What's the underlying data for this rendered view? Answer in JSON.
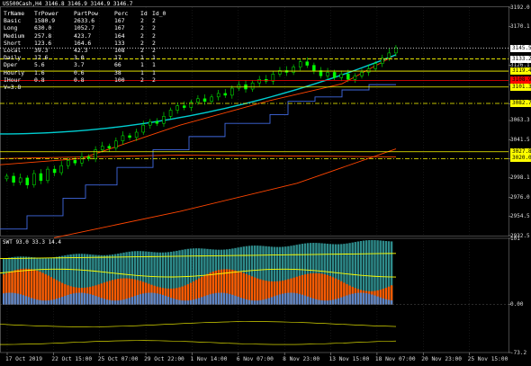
{
  "chart_title": "US500Cash,H4  3146.8 3146.9 3144.9 3146.7",
  "stats_table": {
    "headers": [
      "TrName",
      "TrPower",
      "PartPow",
      "Perc",
      "Id",
      "Id_0"
    ],
    "rows": [
      [
        "Basic",
        "1580.9",
        "2633.6",
        "167",
        "2",
        "2"
      ],
      [
        "Long",
        "630.0",
        "1052.7",
        "167",
        "2",
        "2"
      ],
      [
        "Medium",
        "257.8",
        "423.7",
        "164",
        "2",
        "2"
      ],
      [
        "Short",
        "123.6",
        "164.6",
        "133",
        "2",
        "2"
      ],
      [
        "Local",
        "39.3",
        "42.3",
        "108",
        "2",
        "2"
      ],
      [
        "Daily",
        "17.6",
        "3.0",
        "17",
        "1",
        "1"
      ],
      [
        "Dper",
        "5.6",
        "3.7",
        "66",
        "1",
        "1"
      ],
      [
        "Hourly",
        "1.6",
        "0.6",
        "38",
        "1",
        "1"
      ],
      [
        "IHour",
        "0.8",
        "0.8",
        "100",
        "2",
        "2"
      ]
    ],
    "footer": "V=3.8"
  },
  "oscillator_label": "SWT 93.0 33.3 14.4",
  "colors": {
    "background": "#000000",
    "grid": "#2a2a2a",
    "bull_candle": "#00ff00",
    "channel_line": "#ff4500",
    "cyan_line": "#00ced1",
    "step_line": "#4169e1",
    "level_line": "#ffff00",
    "osc_teal": "#2e8b8b",
    "osc_orange": "#ff5a00",
    "osc_blue": "#5b86c8"
  },
  "chart_data": [
    {
      "type": "line",
      "title": "US500Cash,H4",
      "y_axis_ticks": [
        "3192.0",
        "3170.1",
        "3126.1",
        "3104.1",
        "3082.2",
        "3063.3",
        "3041.5",
        "3019.6",
        "2998.1",
        "2976.0",
        "2954.5",
        "2932.5"
      ],
      "ylim": [
        2932.5,
        3192.0
      ],
      "x_axis_ticks": [
        "17 Oct 2019",
        "22 Oct 15:00",
        "25 Oct 07:00",
        "29 Oct 22:00",
        "1 Nov 14:00",
        "6 Nov 07:00",
        "8 Nov 23:00",
        "13 Nov 15:00",
        "18 Nov 07:00",
        "20 Nov 23:00",
        "25 Nov 15:00"
      ],
      "price_levels": [
        {
          "label": "3145.5",
          "value": 3145.5,
          "bg": "#ffffff",
          "fg": "#000000",
          "style": "dotted",
          "color": "#ffffff"
        },
        {
          "label": "3133.2",
          "value": 3133.2,
          "bg": "#ffffff",
          "fg": "#000000",
          "style": "dashed",
          "color": "#ffff00"
        },
        {
          "label": "3119.4",
          "value": 3119.4,
          "bg": "#ffff00",
          "fg": "#000000",
          "style": "solid",
          "color": "#ffff00"
        },
        {
          "label": "3108.9",
          "value": 3108.9,
          "bg": "#ff0000",
          "fg": "#000000",
          "style": "solid",
          "color": "#ff0000"
        },
        {
          "label": "3101.3",
          "value": 3101.3,
          "bg": "#ffff00",
          "fg": "#000000",
          "style": "solid",
          "color": "#ffff00"
        },
        {
          "label": "3082.7",
          "value": 3082.7,
          "bg": "#ffff00",
          "fg": "#000000",
          "style": "dashdot",
          "color": "#ffff00"
        },
        {
          "label": "3027.8",
          "value": 3027.8,
          "bg": "#ffff00",
          "fg": "#000000",
          "style": "solid",
          "color": "#ffff00"
        },
        {
          "label": "3020.0",
          "value": 3020.0,
          "bg": "#ffff00",
          "fg": "#000000",
          "style": "dashdot",
          "color": "#ffff00"
        }
      ],
      "close_series": [
        3000,
        2993,
        2998,
        2990,
        3003,
        2995,
        3008,
        3004,
        3012,
        3018,
        3015,
        3022,
        3020,
        3030,
        3034,
        3032,
        3040,
        3046,
        3044,
        3050,
        3058,
        3062,
        3060,
        3068,
        3075,
        3080,
        3078,
        3084,
        3088,
        3085,
        3090,
        3094,
        3092,
        3100,
        3104,
        3099,
        3106,
        3110,
        3108,
        3116,
        3120,
        3118,
        3124,
        3130,
        3126,
        3120,
        3114,
        3118,
        3112,
        3116,
        3110,
        3114,
        3118,
        3122,
        3128,
        3134,
        3140,
        3146
      ]
    },
    {
      "type": "area",
      "title": "SWT 93.0 33.3 14.4",
      "y_axis_ticks": [
        "101",
        "0.00",
        "-73.2"
      ],
      "ylim": [
        -73.2,
        101
      ]
    }
  ]
}
